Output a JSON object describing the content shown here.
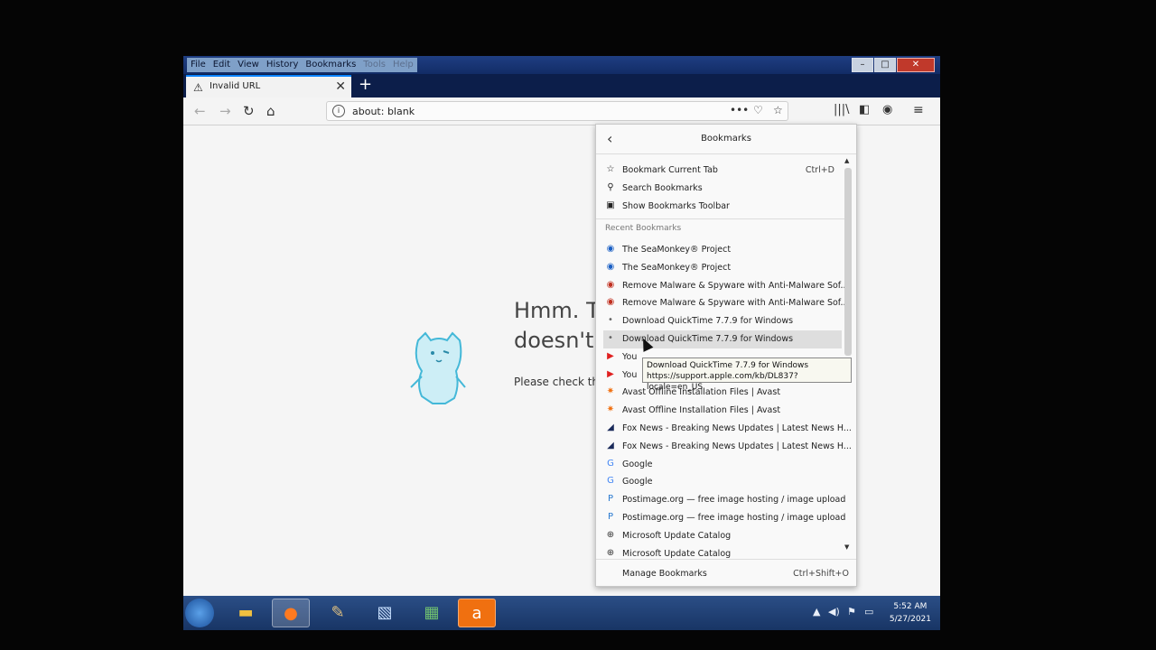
{
  "menubar": {
    "items": [
      "File",
      "Edit",
      "View",
      "History",
      "Bookmarks",
      "Tools",
      "Help"
    ]
  },
  "window": {
    "minimize": "–",
    "maximize": "□",
    "close": "✕"
  },
  "tab": {
    "title": "Invalid URL",
    "new_tab": "+"
  },
  "nav": {
    "url": "about: blank"
  },
  "page": {
    "heading_line1": "Hmm. T",
    "heading_line2": "doesn't",
    "message": "Please check tha"
  },
  "panel": {
    "title": "Bookmarks",
    "actions": [
      {
        "label": "Bookmark Current Tab",
        "shortcut": "Ctrl+D",
        "icon": "star-icon"
      },
      {
        "label": "Search Bookmarks",
        "icon": "search-icon"
      },
      {
        "label": "Show Bookmarks Toolbar",
        "icon": "toolbar-star-icon"
      }
    ],
    "section_label": "Recent Bookmarks",
    "items": [
      {
        "label": "The SeaMonkey® Project",
        "icon": "seamonkey-icon",
        "color": "#1a5fc4"
      },
      {
        "label": "The SeaMonkey® Project",
        "icon": "seamonkey-icon",
        "color": "#1a5fc4"
      },
      {
        "label": "Remove Malware & Spyware with Anti-Malware Sof...",
        "icon": "malware-icon",
        "color": "#c03020"
      },
      {
        "label": "Remove Malware & Spyware with Anti-Malware Sof...",
        "icon": "malware-icon",
        "color": "#c03020"
      },
      {
        "label": "Download QuickTime 7.7.9 for Windows",
        "icon": "apple-icon",
        "color": "#666666"
      },
      {
        "label": "Download QuickTime 7.7.9 for Windows",
        "icon": "apple-icon",
        "color": "#666666"
      },
      {
        "label": "You",
        "icon": "youtube-icon",
        "color": "#e02020"
      },
      {
        "label": "You",
        "icon": "youtube-icon",
        "color": "#e02020"
      },
      {
        "label": "Avast Offline Installation Files | Avast",
        "icon": "avast-icon",
        "color": "#f07010"
      },
      {
        "label": "Avast Offline Installation Files | Avast",
        "icon": "avast-icon",
        "color": "#f07010"
      },
      {
        "label": "Fox News - Breaking News Updates | Latest News H...",
        "icon": "foxnews-icon",
        "color": "#1a2a5a"
      },
      {
        "label": "Fox News - Breaking News Updates | Latest News H...",
        "icon": "foxnews-icon",
        "color": "#1a2a5a"
      },
      {
        "label": "Google",
        "icon": "google-icon",
        "color": "#4285f4"
      },
      {
        "label": "Google",
        "icon": "google-icon",
        "color": "#4285f4"
      },
      {
        "label": "Postimage.org — free image hosting / image upload",
        "icon": "postimage-icon",
        "color": "#2a7ad0"
      },
      {
        "label": "Postimage.org — free image hosting / image upload",
        "icon": "postimage-icon",
        "color": "#2a7ad0"
      },
      {
        "label": "Microsoft Update Catalog",
        "icon": "globe-icon",
        "color": "#333333"
      },
      {
        "label": "Microsoft Update Catalog",
        "icon": "globe-icon",
        "color": "#333333"
      }
    ],
    "footer": {
      "label": "Manage Bookmarks",
      "shortcut": "Ctrl+Shift+O"
    }
  },
  "tooltip": {
    "title": "Download QuickTime 7.7.9 for Windows",
    "url": "https://support.apple.com/kb/DL837?locale=en_US"
  },
  "taskbar": {
    "time": "5:52 AM",
    "date": "5/27/2021"
  }
}
